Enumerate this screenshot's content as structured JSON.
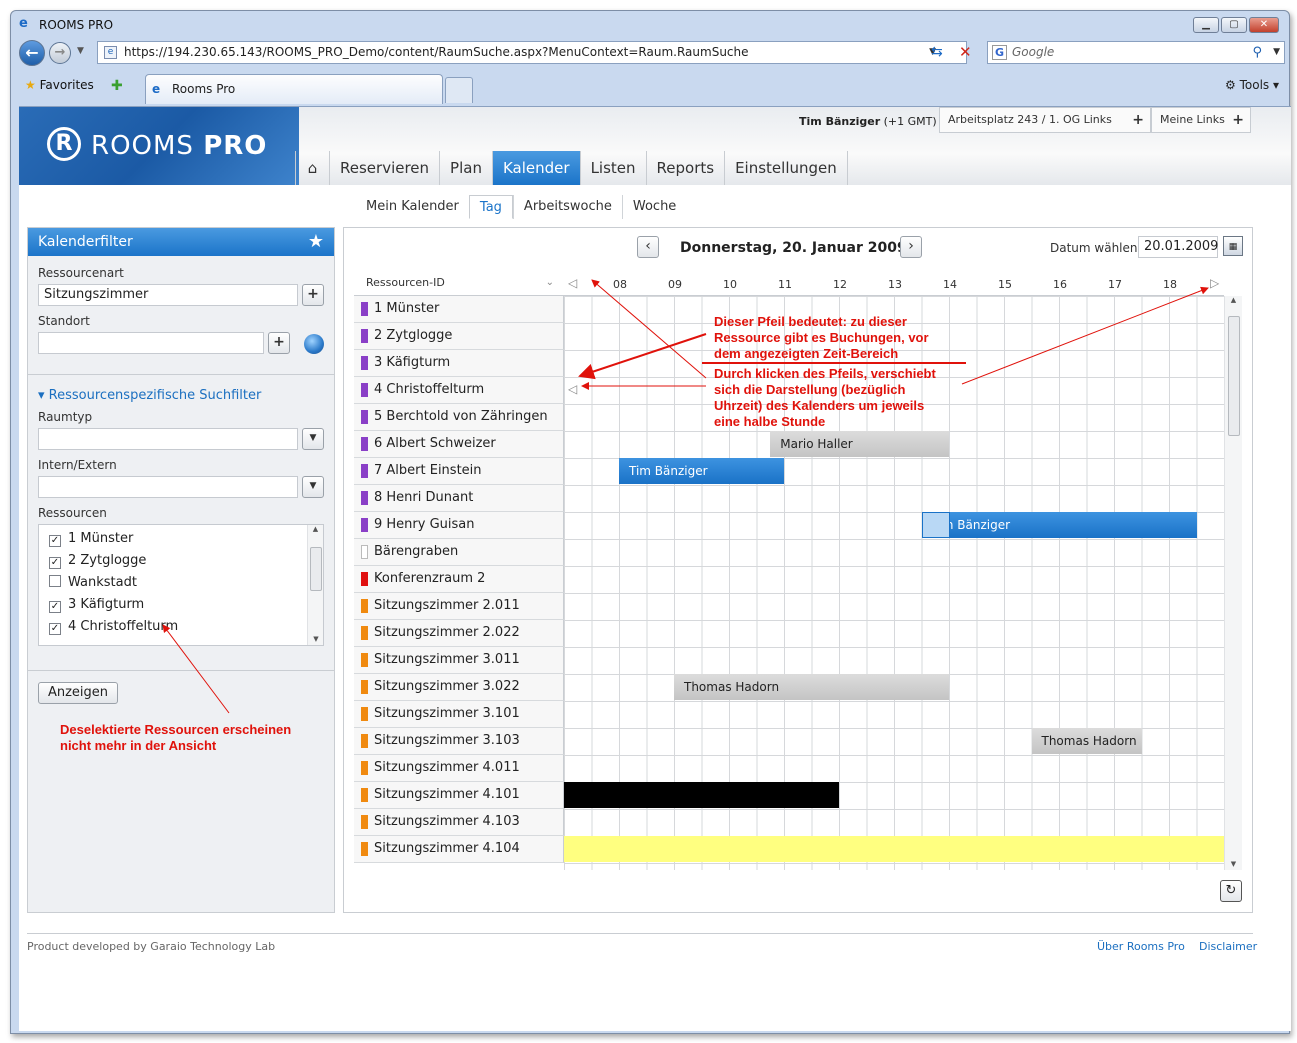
{
  "browser": {
    "window_title": "ROOMS PRO",
    "url": "https://194.230.65.143/ROOMS_PRO_Demo/content/RaumSuche.aspx?MenuContext=Raum.RaumSuche",
    "search_placeholder": "Google",
    "favorites_label": "Favorites",
    "tab_title": "Rooms Pro",
    "tools_label": "Tools"
  },
  "app": {
    "logo_text_a": "ROOMS",
    "logo_text_b": "PRO",
    "user_name": "Tim Bänziger",
    "user_tz": "(+1 GMT)",
    "workplace": "Arbeitsplatz 243 / 1. OG Links",
    "my_links": "Meine Links",
    "nav": [
      "Reservieren",
      "Plan",
      "Kalender",
      "Listen",
      "Reports",
      "Einstellungen"
    ],
    "nav_active": "Kalender",
    "subnav": [
      "Mein Kalender",
      "Tag",
      "Arbeitswoche",
      "Woche"
    ],
    "subnav_active": "Tag"
  },
  "filter": {
    "title": "Kalenderfilter",
    "ressourcenart_label": "Ressourcenart",
    "ressourcenart_value": "Sitzungszimmer",
    "standort_label": "Standort",
    "standort_value": "",
    "section_title": "Ressourcenspezifische Suchfilter",
    "raumtyp_label": "Raumtyp",
    "intern_label": "Intern/Extern",
    "ressourcen_label": "Ressourcen",
    "ressourcen": [
      {
        "label": "1 Münster",
        "checked": true
      },
      {
        "label": "2 Zytglogge",
        "checked": true
      },
      {
        "label": "Wankstadt",
        "checked": false
      },
      {
        "label": "3 Käfigturm",
        "checked": true
      },
      {
        "label": "4 Christoffelturm",
        "checked": true
      }
    ],
    "show_button": "Anzeigen"
  },
  "annotations": {
    "left_note": "Deselektierte Ressourcen erscheinen\nnicht mehr in der Ansicht",
    "note1": "Dieser Pfeil bedeutet: zu dieser\nRessource gibt es Buchungen, vor\ndem angezeigten Zeit-Bereich",
    "note2": "Durch klicken des Pfeils, verschiebt\nsich die Darstellung (bezüglich\nUhrzeit) des Kalenders um jeweils\neine halbe Stunde"
  },
  "calendar": {
    "date_title": "Donnerstag, 20. Januar 2009",
    "date_pick_label": "Datum wählen",
    "date_value": "20.01.2009",
    "resource_header": "Ressourcen-ID",
    "hours": [
      "08",
      "09",
      "10",
      "11",
      "12",
      "13",
      "14",
      "15",
      "16",
      "17",
      "18"
    ],
    "resources": [
      {
        "name": "1 Münster",
        "color": "#8a3fc7"
      },
      {
        "name": "2 Zytglogge",
        "color": "#8a3fc7"
      },
      {
        "name": "3 Käfigturm",
        "color": "#8a3fc7"
      },
      {
        "name": "4 Christoffelturm",
        "color": "#8a3fc7"
      },
      {
        "name": "5 Berchtold von Zähringen",
        "color": "#8a3fc7"
      },
      {
        "name": "6 Albert Schweizer",
        "color": "#8a3fc7"
      },
      {
        "name": "7 Albert Einstein",
        "color": "#8a3fc7"
      },
      {
        "name": "8 Henri Dunant",
        "color": "#8a3fc7"
      },
      {
        "name": "9 Henry Guisan",
        "color": "#8a3fc7"
      },
      {
        "name": "Bärengraben",
        "color": "#ffffff"
      },
      {
        "name": "Konferenzraum 2",
        "color": "#e01010"
      },
      {
        "name": "Sitzungszimmer 2.011",
        "color": "#f08a10"
      },
      {
        "name": "Sitzungszimmer 2.022",
        "color": "#f08a10"
      },
      {
        "name": "Sitzungszimmer 3.011",
        "color": "#f08a10"
      },
      {
        "name": "Sitzungszimmer 3.022",
        "color": "#f08a10"
      },
      {
        "name": "Sitzungszimmer 3.101",
        "color": "#f08a10"
      },
      {
        "name": "Sitzungszimmer 3.103",
        "color": "#f08a10"
      },
      {
        "name": "Sitzungszimmer 4.011",
        "color": "#f08a10"
      },
      {
        "name": "Sitzungszimmer 4.101",
        "color": "#f08a10"
      },
      {
        "name": "Sitzungszimmer 4.103",
        "color": "#f08a10"
      },
      {
        "name": "Sitzungszimmer 4.104",
        "color": "#f08a10"
      }
    ],
    "bookings": [
      {
        "row": 5,
        "start": "10:45",
        "end": "14:00",
        "label": "Mario Haller",
        "style": "gray"
      },
      {
        "row": 6,
        "start": "08:00",
        "end": "11:00",
        "label": "Tim Bänziger",
        "style": "blue"
      },
      {
        "row": 8,
        "start": "13:30",
        "end": "18:30",
        "label": "Tim Bänziger",
        "style": "blue"
      },
      {
        "row": 14,
        "start": "09:00",
        "end": "14:00",
        "label": "Thomas Hadorn",
        "style": "gray"
      },
      {
        "row": 16,
        "start": "15:30",
        "end": "17:30",
        "label": "Thomas Hadorn",
        "style": "gray"
      },
      {
        "row": 18,
        "start": "07:00",
        "end": "12:00",
        "label": "",
        "style": "black"
      },
      {
        "row": 20,
        "start": "07:00",
        "end": "19:00",
        "label": "",
        "style": "yellow"
      }
    ]
  },
  "footer": {
    "credit": "Product developed by Garaio Technology Lab",
    "about": "Über Rooms Pro",
    "disclaimer": "Disclaimer"
  }
}
